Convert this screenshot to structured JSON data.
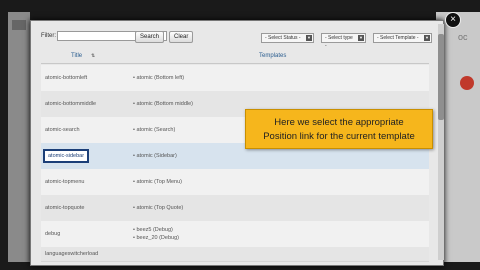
{
  "background": {
    "right_ghost_text": "oc",
    "accent_color": "#f6b61c"
  },
  "modal": {
    "close_label": "×",
    "filter": {
      "label": "Filter:",
      "value": "",
      "search_label": "Search",
      "clear_label": "Clear"
    },
    "selects": {
      "status": "- Select Status -",
      "type": "- Select type -",
      "template": "- Select Template -"
    },
    "table": {
      "col_title": "Title",
      "col_templates": "Templates",
      "rows": [
        {
          "position": "atomic-bottomleft",
          "templates": [
            "• atomic (Bottom left)"
          ]
        },
        {
          "position": "atomic-bottommiddle",
          "templates": [
            "• atomic (Bottom middle)"
          ]
        },
        {
          "position": "atomic-search",
          "templates": [
            "• atomic (Search)"
          ]
        },
        {
          "position": "atomic-sidebar",
          "templates": [
            "• atomic (Sidebar)"
          ],
          "selected": true
        },
        {
          "position": "atomic-topmenu",
          "templates": [
            "• atomic (Top Menu)"
          ]
        },
        {
          "position": "atomic-topquote",
          "templates": [
            "• atomic (Top Quote)"
          ]
        },
        {
          "position": "debug",
          "templates": [
            "• beez5 (Debug)",
            "• beez_20 (Debug)"
          ]
        },
        {
          "position": "languageswitcherload",
          "templates": [
            ""
          ]
        }
      ]
    }
  },
  "callout": {
    "line1": "Here we select the appropriate",
    "line2": "Position link for the current template"
  }
}
